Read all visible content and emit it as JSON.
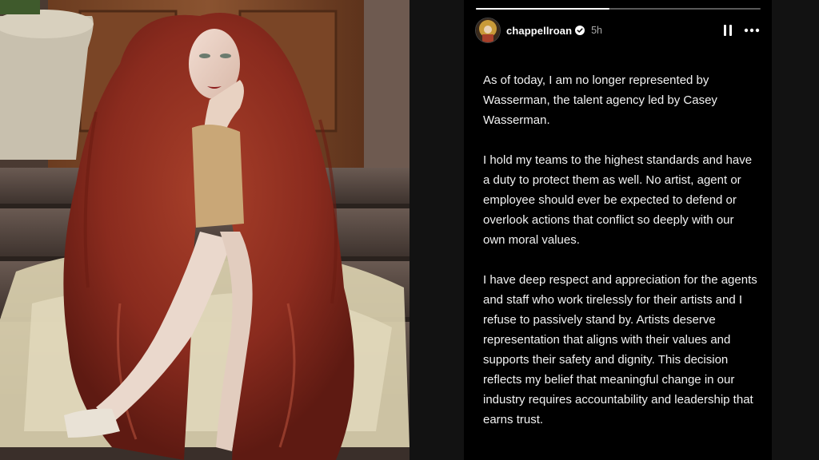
{
  "story": {
    "username": "chappellroan",
    "timestamp": "5h",
    "progress": 0.47,
    "icons": {
      "verified": "verified-badge-icon",
      "pause": "pause-icon",
      "more": "more-options-icon"
    },
    "paragraphs": [
      "As of today, I am no longer represented by Wasserman, the talent agency led by Casey Wasserman.",
      "I hold my teams to the highest standards and have a duty to protect them as well. No artist, agent or employee should ever be expected to defend or overlook actions that conflict so deeply with our own moral values.",
      "I have deep respect and appreciation for the agents and staff who work tirelessly for their artists and I refuse to passively stand by. Artists deserve representation that aligns with their values and supports their safety and dignity. This decision reflects my belief that meaningful change in our industry requires accountability and leadership that earns trust."
    ]
  },
  "colors": {
    "panel_background": "#000000",
    "page_background": "#141414",
    "text": "#f2f2f2",
    "timestamp": "#aaaaaa",
    "hair": "#8a2b1e"
  }
}
